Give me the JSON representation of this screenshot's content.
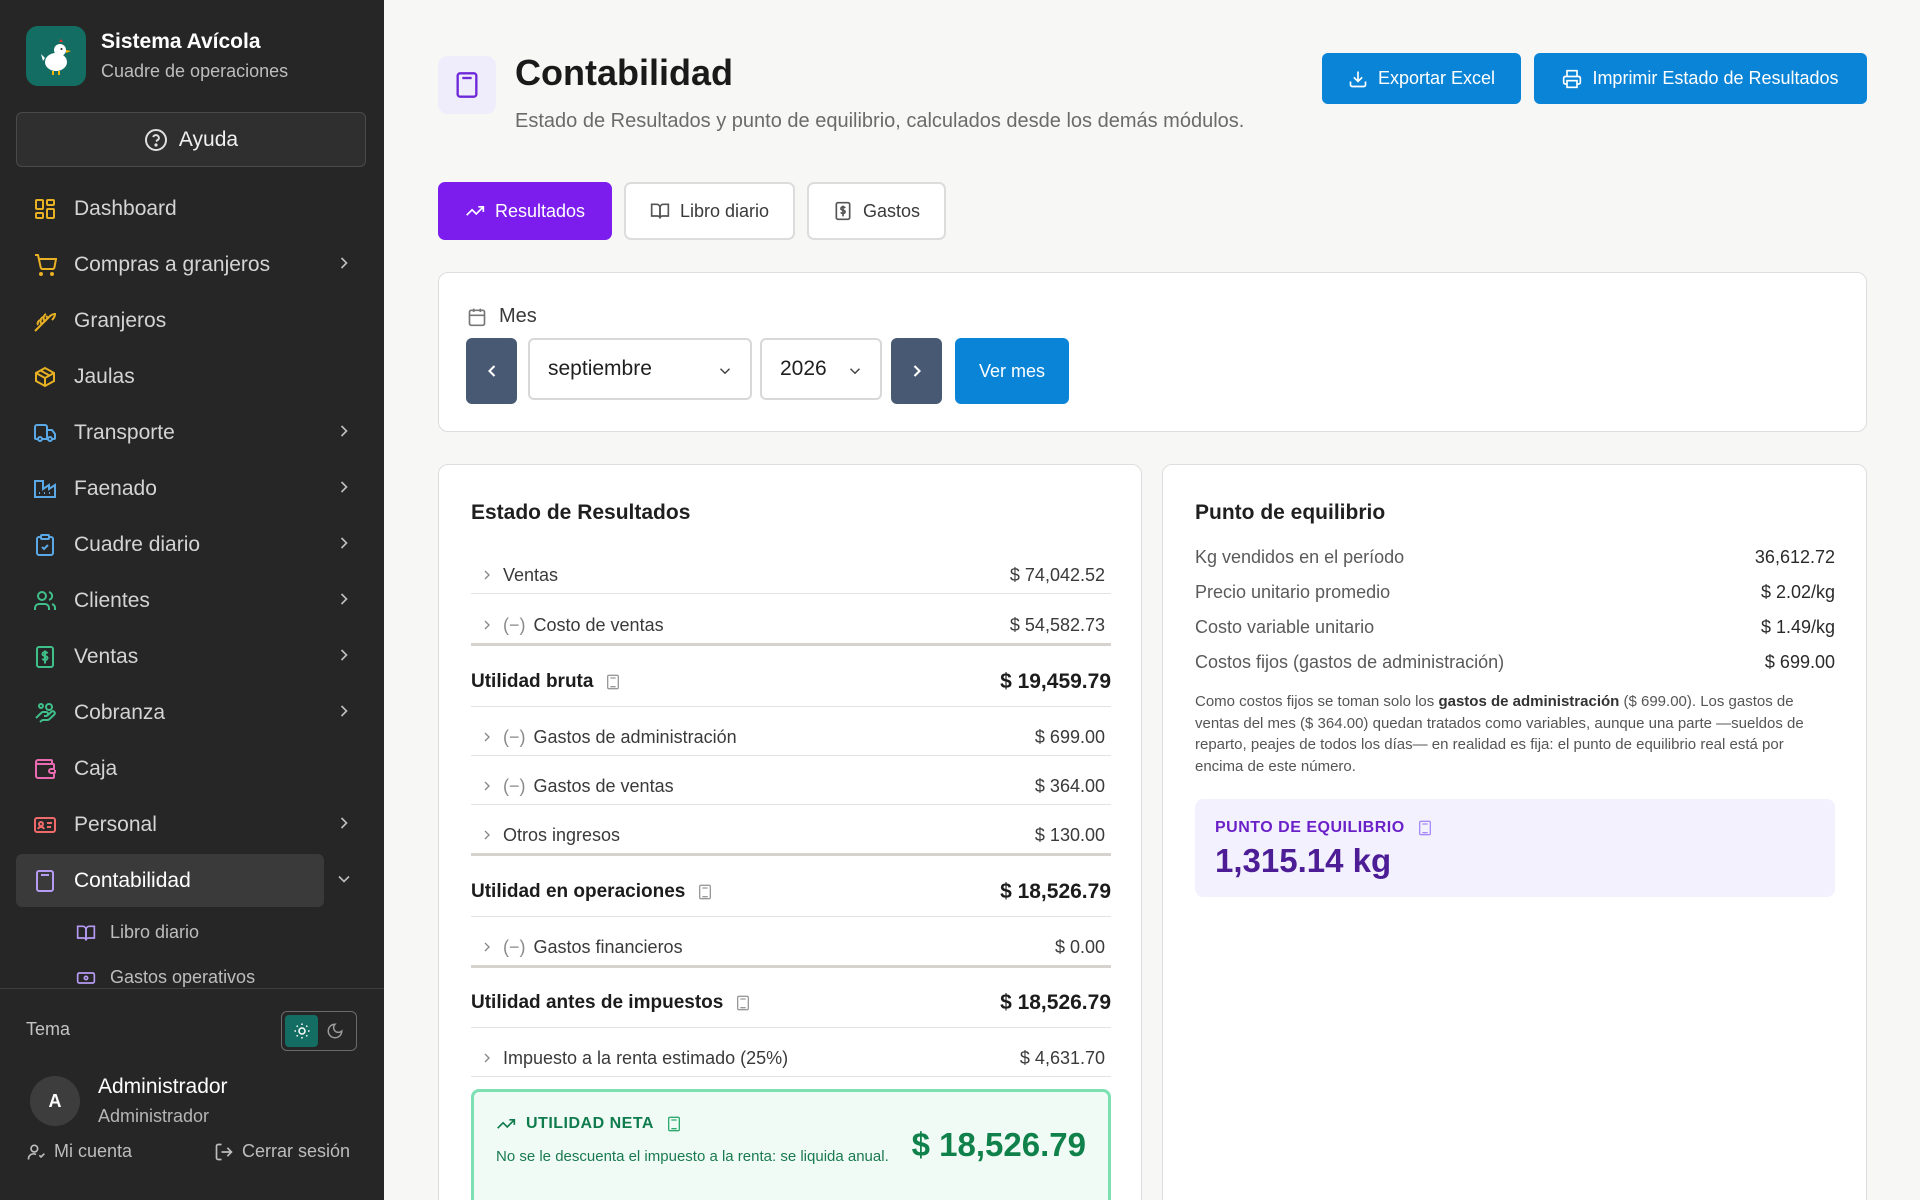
{
  "brand": {
    "title": "Sistema Avícola",
    "subtitle": "Cuadre de operaciones"
  },
  "help_label": "Ayuda",
  "nav": [
    {
      "label": "Dashboard",
      "icon": "dashboard-icon",
      "has_children": false
    },
    {
      "label": "Compras a granjeros",
      "icon": "cart-icon",
      "has_children": true
    },
    {
      "label": "Granjeros",
      "icon": "wheat-icon",
      "has_children": false
    },
    {
      "label": "Jaulas",
      "icon": "box-icon",
      "has_children": false
    },
    {
      "label": "Transporte",
      "icon": "truck-icon",
      "has_children": true
    },
    {
      "label": "Faenado",
      "icon": "factory-icon",
      "has_children": true
    },
    {
      "label": "Cuadre diario",
      "icon": "clipboard-icon",
      "has_children": true
    },
    {
      "label": "Clientes",
      "icon": "users-icon",
      "has_children": true
    },
    {
      "label": "Ventas",
      "icon": "receipt-icon",
      "has_children": true
    },
    {
      "label": "Cobranza",
      "icon": "hand-coins-icon",
      "has_children": true
    },
    {
      "label": "Caja",
      "icon": "wallet-icon",
      "has_children": false
    },
    {
      "label": "Personal",
      "icon": "id-card-icon",
      "has_children": true
    },
    {
      "label": "Contabilidad",
      "icon": "calculator-icon",
      "has_children": true,
      "active": true
    }
  ],
  "subnav": [
    {
      "label": "Libro diario",
      "icon": "book-icon"
    },
    {
      "label": "Gastos operativos",
      "icon": "banknote-icon"
    }
  ],
  "theme": {
    "label": "Tema",
    "mode": "light"
  },
  "user": {
    "initial": "A",
    "name": "Administrador",
    "role": "Administrador"
  },
  "account_label": "Mi cuenta",
  "logout_label": "Cerrar sesión",
  "page": {
    "title": "Contabilidad",
    "subtitle": "Estado de Resultados y punto de equilibrio, calculados desde los demás módulos.",
    "export_label": "Exportar Excel",
    "print_label": "Imprimir Estado de Resultados"
  },
  "tabs": [
    {
      "label": "Resultados",
      "active": true
    },
    {
      "label": "Libro diario",
      "active": false
    },
    {
      "label": "Gastos",
      "active": false
    }
  ],
  "month_filter": {
    "label": "Mes",
    "month": "septiembre",
    "year": "2026",
    "view_label": "Ver mes"
  },
  "estado": {
    "title": "Estado de Resultados",
    "ventas": {
      "label": "Ventas",
      "value": "$ 74,042.52"
    },
    "costo_ventas": {
      "sign": "(−)",
      "label": "Costo de ventas",
      "value": "$ 54,582.73"
    },
    "utilidad_bruta": {
      "label": "Utilidad bruta",
      "value": "$ 19,459.79"
    },
    "gastos_admin": {
      "sign": "(−)",
      "label": "Gastos de administración",
      "value": "$ 699.00"
    },
    "gastos_ventas": {
      "sign": "(−)",
      "label": "Gastos de ventas",
      "value": "$ 364.00"
    },
    "otros_ingresos": {
      "label": "Otros ingresos",
      "value": "$ 130.00"
    },
    "utilidad_operaciones": {
      "label": "Utilidad en operaciones",
      "value": "$ 18,526.79"
    },
    "gastos_financieros": {
      "sign": "(−)",
      "label": "Gastos financieros",
      "value": "$ 0.00"
    },
    "utilidad_antes_imp": {
      "label": "Utilidad antes de impuestos",
      "value": "$ 18,526.79"
    },
    "impuesto": {
      "label": "Impuesto a la renta estimado (25%)",
      "value": "$ 4,631.70"
    },
    "neta": {
      "label": "UTILIDAD NETA",
      "note": "No se le descuenta el impuesto a la renta: se liquida anual.",
      "value": "$ 18,526.79"
    }
  },
  "equilibrio": {
    "title": "Punto de equilibrio",
    "rows": [
      {
        "label": "Kg vendidos en el período",
        "value": "36,612.72"
      },
      {
        "label": "Precio unitario promedio",
        "value": "$ 2.02/kg"
      },
      {
        "label": "Costo variable unitario",
        "value": "$ 1.49/kg"
      },
      {
        "label": "Costos fijos (gastos de administración)",
        "value": "$ 699.00"
      }
    ],
    "note_pre": "Como costos fijos se toman solo los ",
    "note_bold": "gastos de administración",
    "note_post": " ($ 699.00). Los gastos de ventas del mes ($ 364.00) quedan tratados como variables, aunque una parte —sueldos de reparto, peajes de todos los días— en realidad es fija: el punto de equilibrio real está por encima de este número.",
    "box_label": "PUNTO DE EQUILIBRIO",
    "box_value": "1,315.14 kg"
  },
  "colors": {
    "accent_purple": "#7c1dee",
    "primary_blue": "#0a84d6",
    "sidebar_bg": "#262626",
    "brand_teal": "#136d63",
    "success_green": "#10814a"
  }
}
